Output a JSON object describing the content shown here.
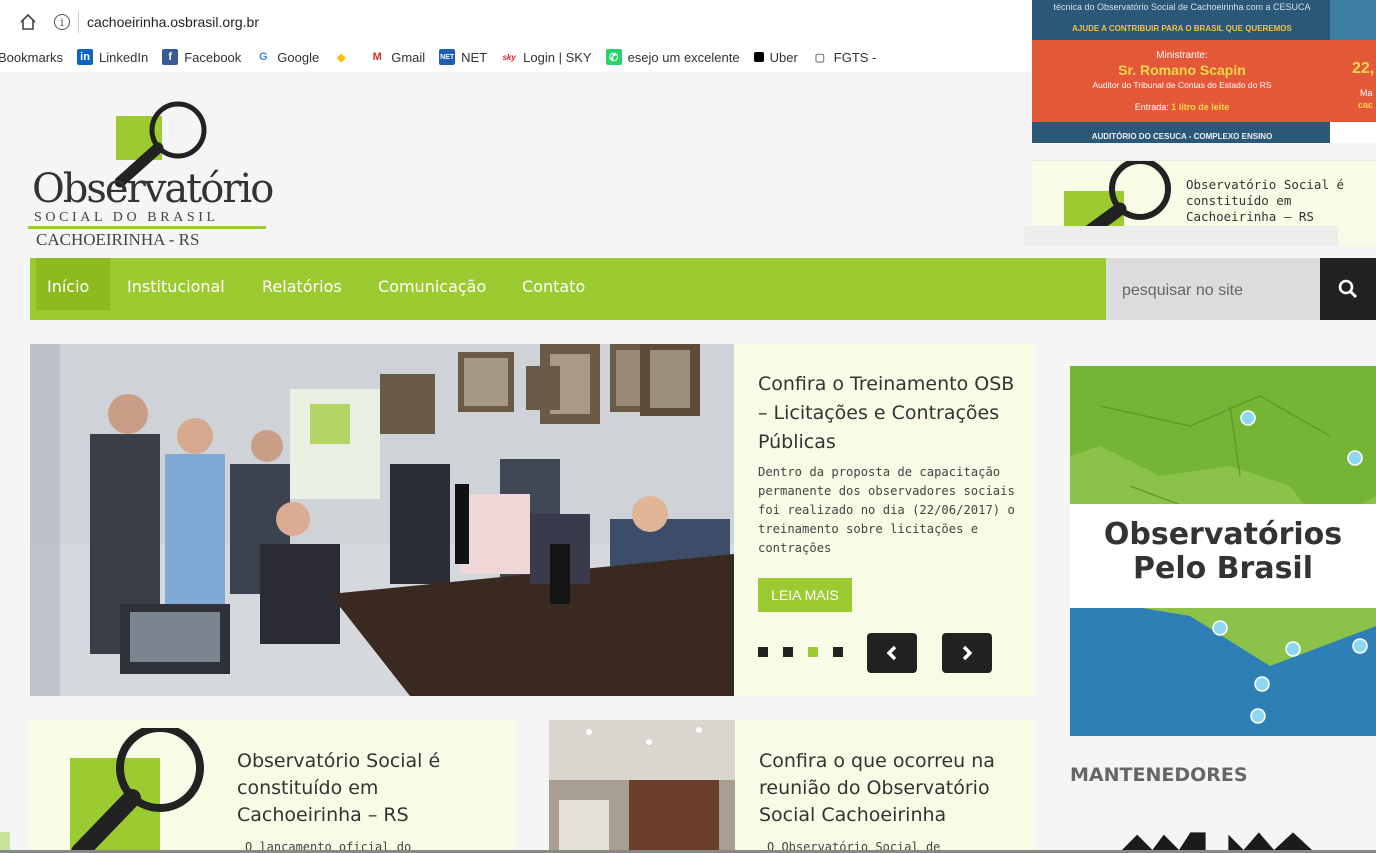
{
  "browser": {
    "url": "cachoeirinha.osbrasil.org.br",
    "bookmarks": [
      {
        "label": "Bookmarks",
        "icon": "bookmarks-icon"
      },
      {
        "label": "LinkedIn",
        "icon": "linkedin-icon"
      },
      {
        "label": "Facebook",
        "icon": "facebook-icon"
      },
      {
        "label": "Google",
        "icon": "google-icon"
      },
      {
        "label": "",
        "icon": "apps-icon"
      },
      {
        "label": "Gmail",
        "icon": "gmail-icon"
      },
      {
        "label": "NET",
        "icon": "net-icon"
      },
      {
        "label": "Login | SKY",
        "icon": "sky-icon"
      },
      {
        "label": "esejo um excelente",
        "icon": "whatsapp-icon"
      },
      {
        "label": "Uber",
        "icon": "uber-icon"
      },
      {
        "label": "FGTS -",
        "icon": "page-icon"
      }
    ]
  },
  "logo": {
    "title": "Observatório",
    "line2": "SOCIAL DO BRASIL",
    "line3": "CACHOEIRINHA - RS"
  },
  "nav": {
    "items": [
      "Início",
      "Institucional",
      "Relatórios",
      "Comunicação",
      "Contato"
    ],
    "search_placeholder": "pesquisar no site"
  },
  "hero": {
    "title": "Confira o Treinamento OSB – Licitações e Contrações Públicas",
    "body": "  Dentro da proposta de capacitação permanente dos observadores sociais foi realizado no dia (22/06/2017) o treinamento sobre licitações e contrações",
    "button": "LEIA MAIS",
    "active_dot": 3
  },
  "cards": [
    {
      "title": "Observatório Social é constituído em Cachoeirinha – RS",
      "body": "O lançamento oficial do"
    },
    {
      "title": "Confira o que ocorreu na reunião do Observatório Social Cachoeirinha",
      "body": "O Observatório Social de"
    }
  ],
  "ad": {
    "top_text": "técnica do Observatório Social de Cachoeirinha com a CESUCA",
    "banner": "AJUDE A CONTRIBUIR PARA O BRASIL QUE QUEREMOS",
    "ministrante_label": "Ministrante:",
    "ministrante": "Sr. Romano Scapin",
    "role": "Auditor do Tribunal de Contas do Estado do RS",
    "entrada": "Entrada:",
    "entrada_val": "1 litro de leite",
    "local": "AUDITÓRIO DO CESUCA - COMPLEXO ENSINO",
    "date_frag": "22,",
    "side_frag1": "Ma",
    "side_frag2": "cac"
  },
  "popup": {
    "text": "Observatório Social é constituído em Cachoeirinha – RS"
  },
  "sidebar": {
    "map_title": "Observatórios Pelo Brasil",
    "mantenedores": "MANTENEDORES"
  },
  "colors": {
    "green": "#9ccb31",
    "dark": "#222222",
    "panel": "#f8fce6"
  }
}
